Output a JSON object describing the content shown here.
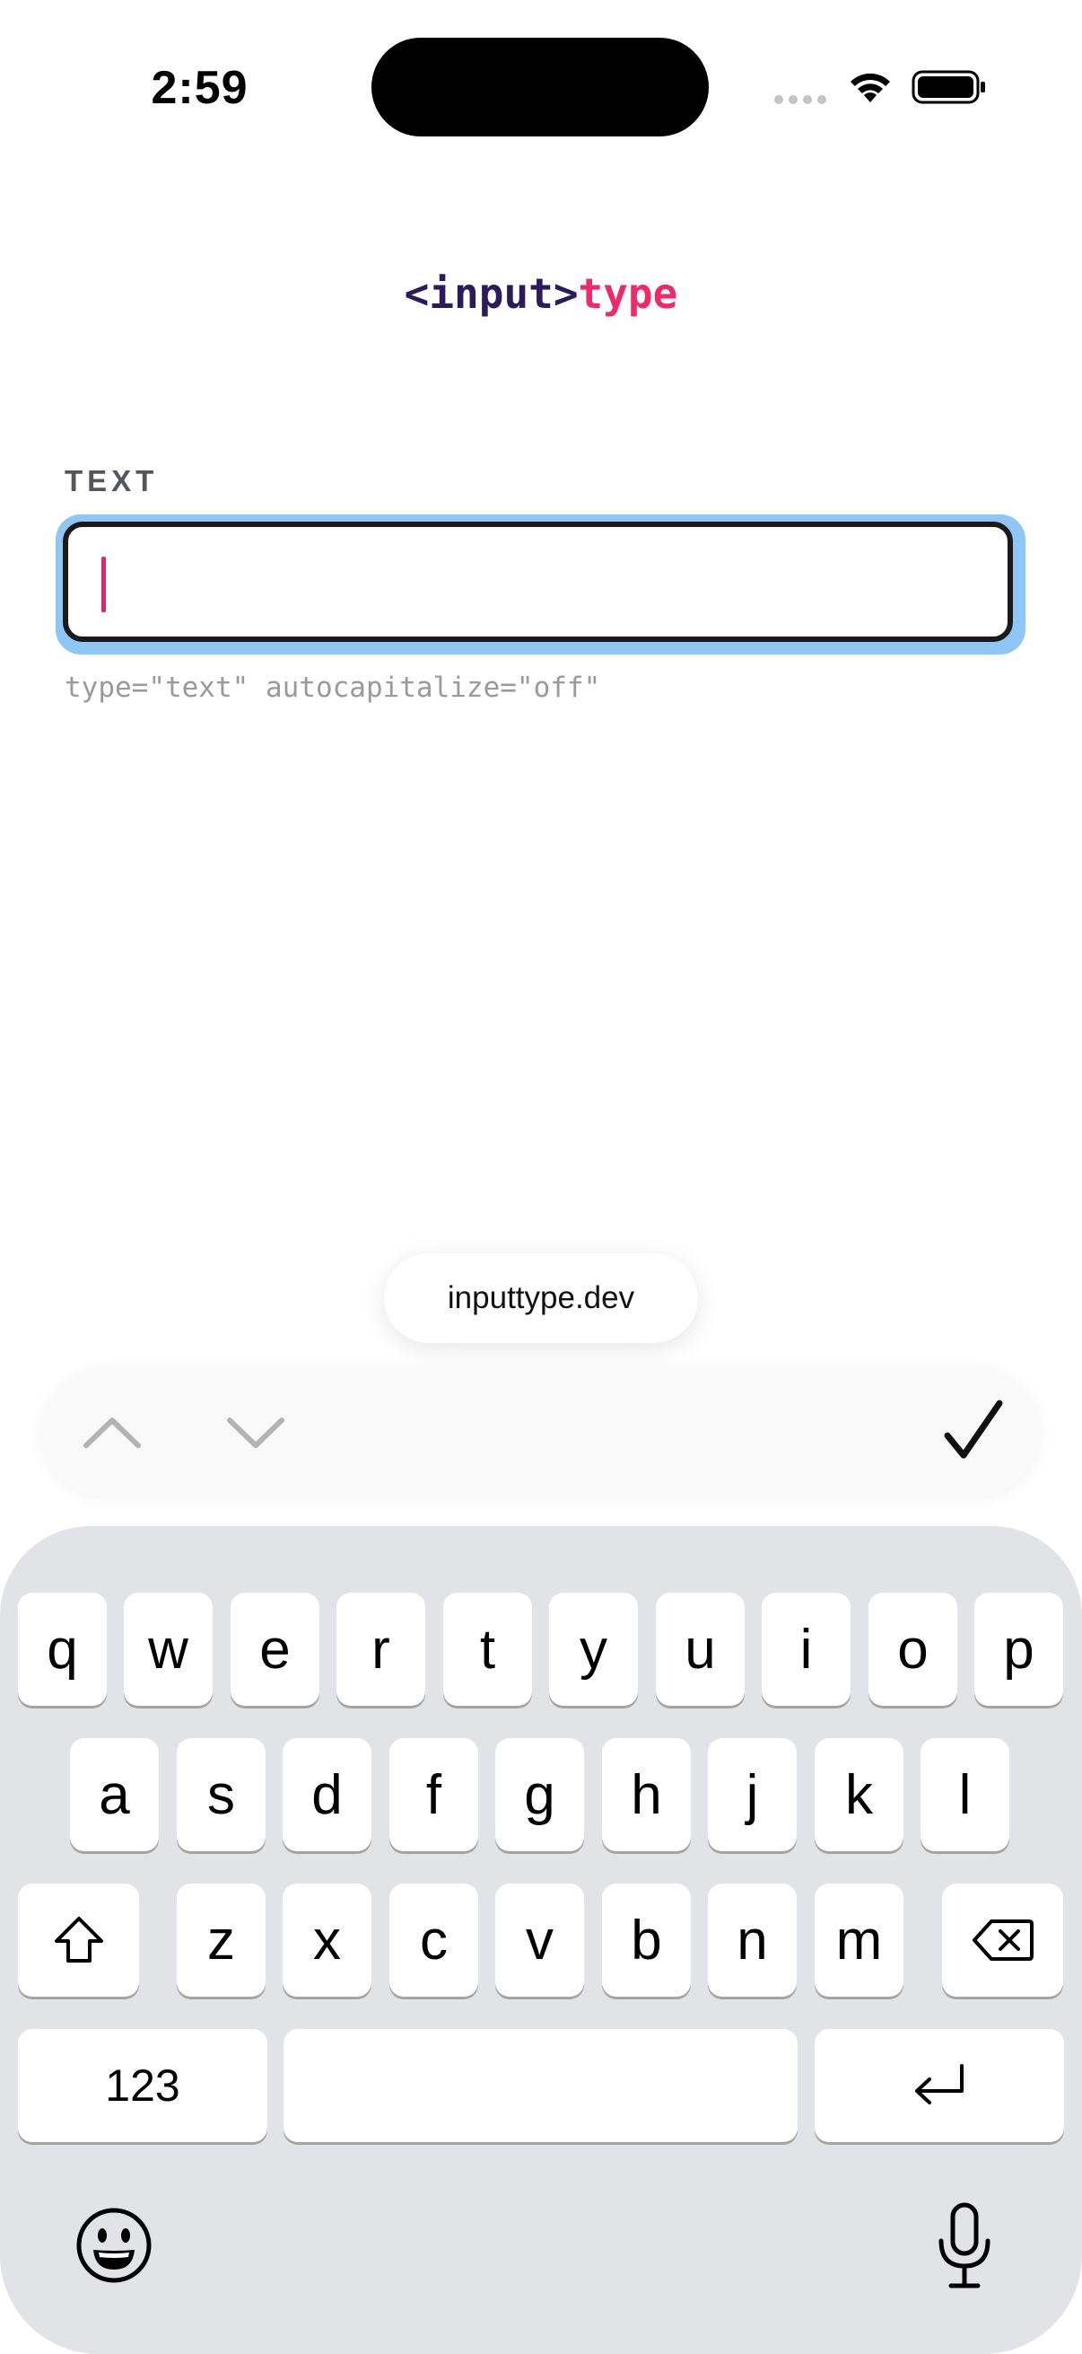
{
  "status_bar": {
    "time": "2:59"
  },
  "logo": {
    "tag_text": "<input>",
    "type_text": "type"
  },
  "form": {
    "label": "TEXT",
    "input_value": "",
    "input_placeholder": "",
    "hint": "type=\"text\" autocapitalize=\"off\""
  },
  "browser": {
    "url": "inputtype.dev"
  },
  "toolbar": {
    "prev_icon": "chevron-up-icon",
    "next_icon": "chevron-down-icon",
    "done_icon": "checkmark-icon"
  },
  "keyboard": {
    "row1": [
      "q",
      "w",
      "e",
      "r",
      "t",
      "y",
      "u",
      "i",
      "o",
      "p"
    ],
    "row2": [
      "a",
      "s",
      "d",
      "f",
      "g",
      "h",
      "j",
      "k",
      "l"
    ],
    "row3": [
      "z",
      "x",
      "c",
      "v",
      "b",
      "n",
      "m"
    ],
    "numbers_label": "123",
    "space_label": "",
    "shift_icon": "shift-icon",
    "delete_icon": "delete-icon",
    "return_icon": "return-icon",
    "emoji_icon": "emoji-icon",
    "mic_icon": "microphone-icon"
  },
  "colors": {
    "accent": "#ef2a6b",
    "logo_dark": "#2b1b5c",
    "focus_ring": "#8fc6f5",
    "keyboard_bg": "#e2e3e7"
  }
}
